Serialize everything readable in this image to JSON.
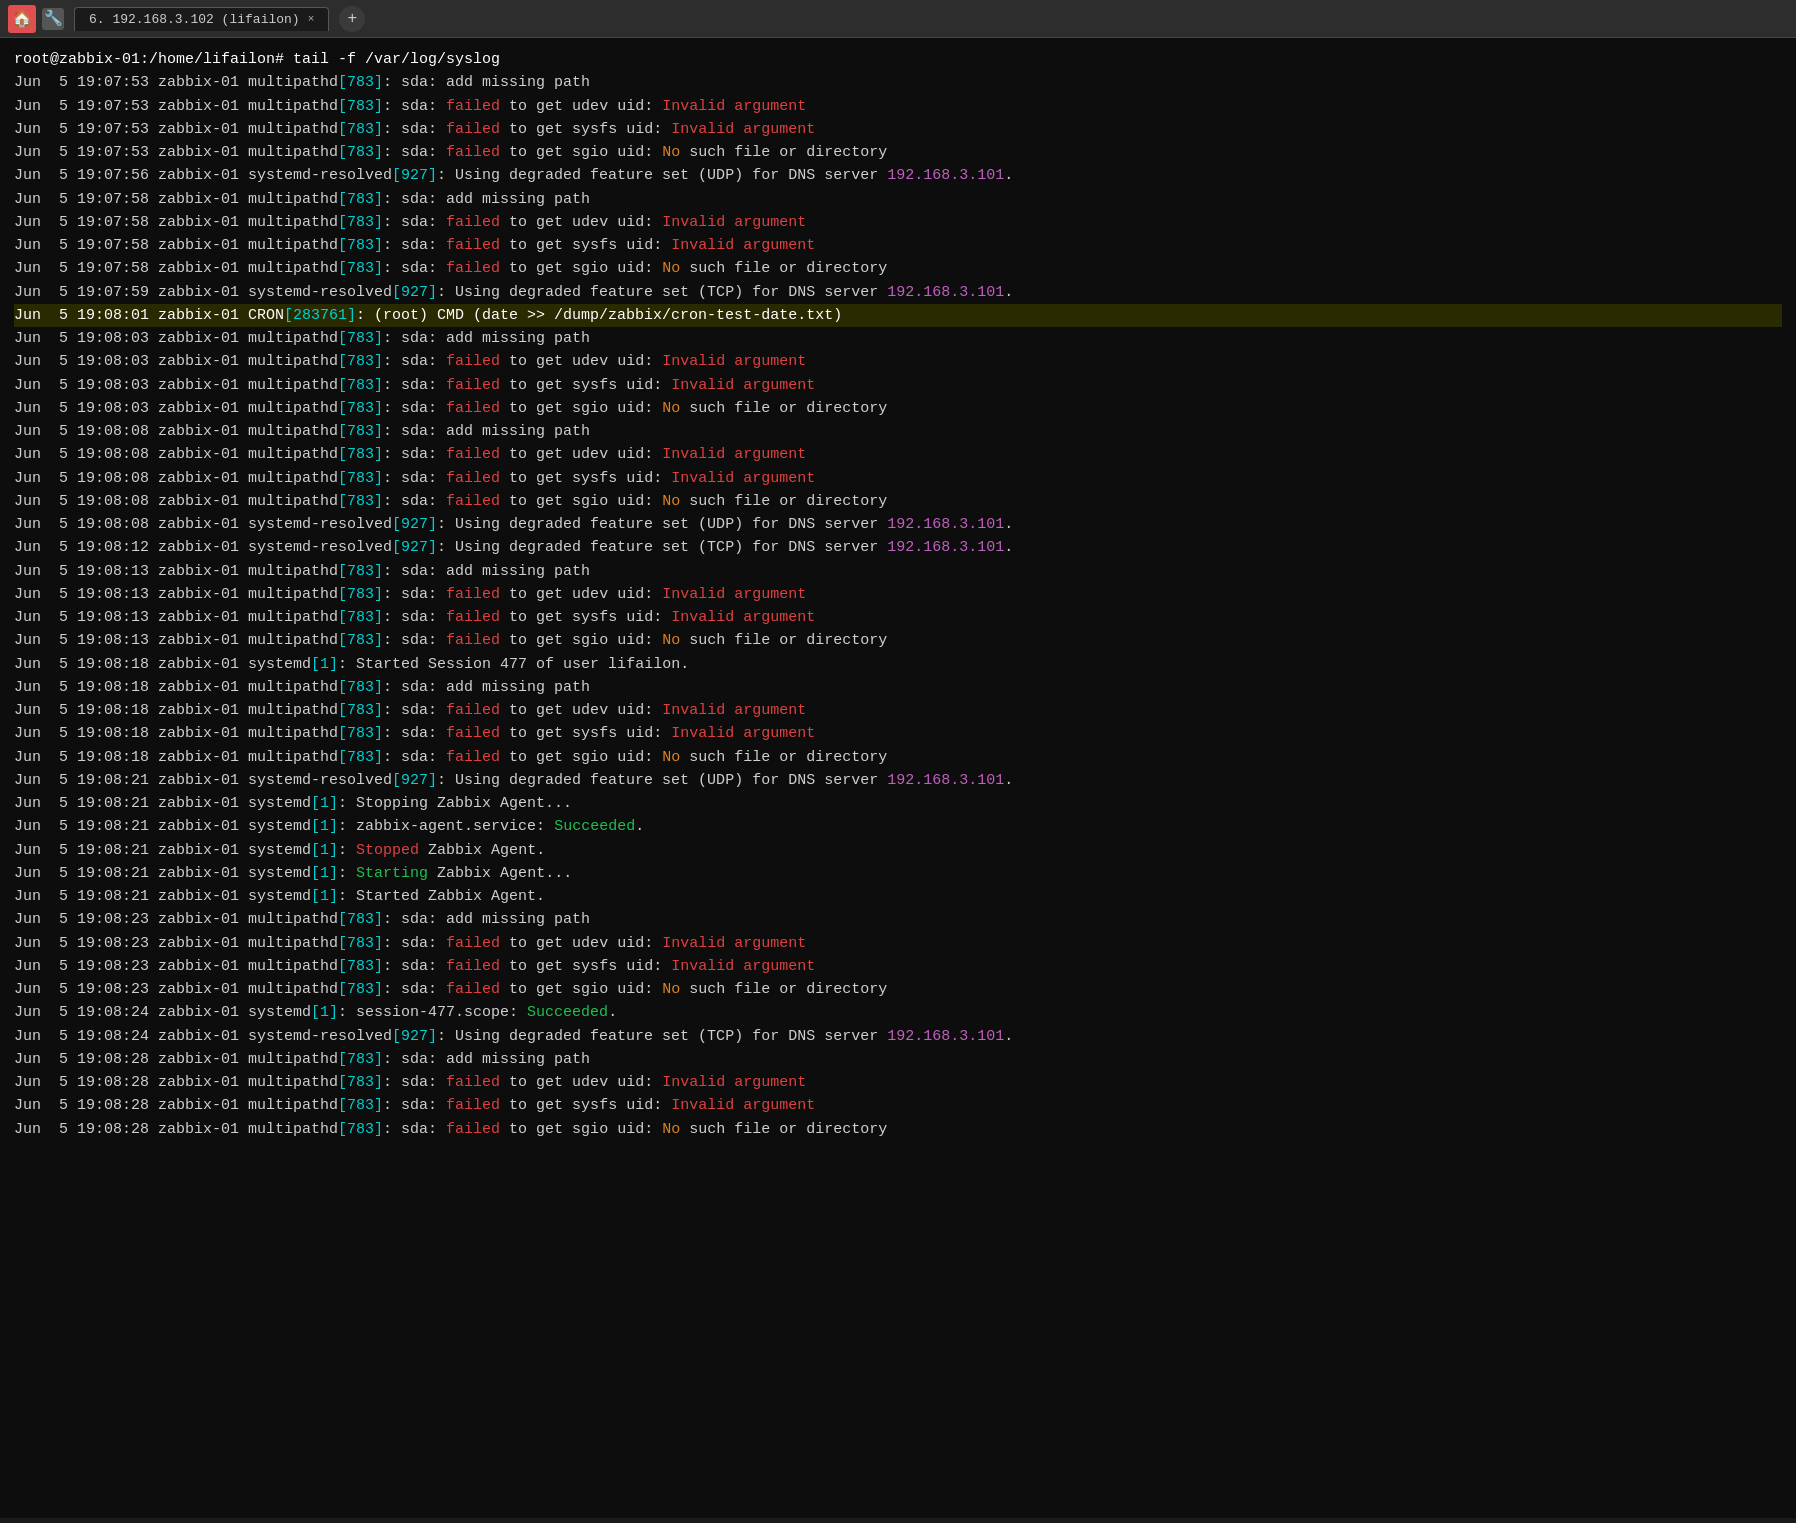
{
  "titlebar": {
    "icon": "🏠",
    "tab_label": "6. 192.168.3.102 (lifailon)",
    "tab_close": "×",
    "add_tab": "+"
  },
  "terminal": {
    "prompt": "root@zabbix-01:/home/lifailon# tail -f /var/log/syslog",
    "lines": [
      {
        "id": 1,
        "prefix": "Jun  5 19:07:53 zabbix-01 multipathd",
        "pid": "[783]",
        "msg": ": sda: add missing path",
        "type": "plain"
      },
      {
        "id": 2,
        "prefix": "Jun  5 19:07:53 zabbix-01 multipathd",
        "pid": "[783]",
        "msg_start": ": sda: ",
        "msg_fail": "failed",
        "msg_end": " to get udev uid: ",
        "msg_err": "Invalid argument",
        "type": "fail"
      },
      {
        "id": 3,
        "prefix": "Jun  5 19:07:53 zabbix-01 multipathd",
        "pid": "[783]",
        "msg_start": ": sda: ",
        "msg_fail": "failed",
        "msg_end": " to get sysfs uid: ",
        "msg_err": "Invalid argument",
        "type": "fail"
      },
      {
        "id": 4,
        "prefix": "Jun  5 19:07:53 zabbix-01 multipathd",
        "pid": "[783]",
        "msg_start": ": sda: ",
        "msg_fail": "failed",
        "msg_end": " to get sgio uid: ",
        "msg_no": "No",
        "msg_no_rest": " such file or directory",
        "type": "fail_no"
      },
      {
        "id": 5,
        "prefix": "Jun  5 19:07:56 zabbix-01 systemd-resolved",
        "pid": "[927]",
        "msg_start": ": Using degraded feature set (UDP) for DNS server ",
        "msg_ip": "192.168.3.101",
        "msg_end": ".",
        "type": "resolved"
      },
      {
        "id": 6,
        "prefix": "Jun  5 19:07:58 zabbix-01 multipathd",
        "pid": "[783]",
        "msg": ": sda: add missing path",
        "type": "plain"
      },
      {
        "id": 7,
        "prefix": "Jun  5 19:07:58 zabbix-01 multipathd",
        "pid": "[783]",
        "msg_start": ": sda: ",
        "msg_fail": "failed",
        "msg_end": " to get udev uid: ",
        "msg_err": "Invalid argument",
        "type": "fail"
      },
      {
        "id": 8,
        "prefix": "Jun  5 19:07:58 zabbix-01 multipathd",
        "pid": "[783]",
        "msg_start": ": sda: ",
        "msg_fail": "failed",
        "msg_end": " to get sysfs uid: ",
        "msg_err": "Invalid argument",
        "type": "fail"
      },
      {
        "id": 9,
        "prefix": "Jun  5 19:07:58 zabbix-01 multipathd",
        "pid": "[783]",
        "msg_start": ": sda: ",
        "msg_fail": "failed",
        "msg_end": " to get sgio uid: ",
        "msg_no": "No",
        "msg_no_rest": " such file or directory",
        "type": "fail_no"
      },
      {
        "id": 10,
        "prefix": "Jun  5 19:07:59 zabbix-01 systemd-resolved",
        "pid": "[927]",
        "msg_start": ": Using degraded feature set (TCP) for DNS server ",
        "msg_ip": "192.168.3.101",
        "msg_end": ".",
        "type": "resolved"
      },
      {
        "id": 11,
        "prefix": "Jun  5 19:08:01 zabbix-01 CRON",
        "pid": "[283761]",
        "msg": ": (root) CMD (date >> /dump/zabbix/cron-test-date.txt)",
        "type": "cron"
      },
      {
        "id": 12,
        "prefix": "Jun  5 19:08:03 zabbix-01 multipathd",
        "pid": "[783]",
        "msg": ": sda: add missing path",
        "type": "plain"
      },
      {
        "id": 13,
        "prefix": "Jun  5 19:08:03 zabbix-01 multipathd",
        "pid": "[783]",
        "msg_start": ": sda: ",
        "msg_fail": "failed",
        "msg_end": " to get udev uid: ",
        "msg_err": "Invalid argument",
        "type": "fail"
      },
      {
        "id": 14,
        "prefix": "Jun  5 19:08:03 zabbix-01 multipathd",
        "pid": "[783]",
        "msg_start": ": sda: ",
        "msg_fail": "failed",
        "msg_end": " to get sysfs uid: ",
        "msg_err": "Invalid argument",
        "type": "fail"
      },
      {
        "id": 15,
        "prefix": "Jun  5 19:08:03 zabbix-01 multipathd",
        "pid": "[783]",
        "msg_start": ": sda: ",
        "msg_fail": "failed",
        "msg_end": " to get sgio uid: ",
        "msg_no": "No",
        "msg_no_rest": " such file or directory",
        "type": "fail_no"
      },
      {
        "id": 16,
        "prefix": "Jun  5 19:08:08 zabbix-01 multipathd",
        "pid": "[783]",
        "msg": ": sda: add missing path",
        "type": "plain"
      },
      {
        "id": 17,
        "prefix": "Jun  5 19:08:08 zabbix-01 multipathd",
        "pid": "[783]",
        "msg_start": ": sda: ",
        "msg_fail": "failed",
        "msg_end": " to get udev uid: ",
        "msg_err": "Invalid argument",
        "type": "fail"
      },
      {
        "id": 18,
        "prefix": "Jun  5 19:08:08 zabbix-01 multipathd",
        "pid": "[783]",
        "msg_start": ": sda: ",
        "msg_fail": "failed",
        "msg_end": " to get sysfs uid: ",
        "msg_err": "Invalid argument",
        "type": "fail"
      },
      {
        "id": 19,
        "prefix": "Jun  5 19:08:08 zabbix-01 multipathd",
        "pid": "[783]",
        "msg_start": ": sda: ",
        "msg_fail": "failed",
        "msg_end": " to get sgio uid: ",
        "msg_no": "No",
        "msg_no_rest": " such file or directory",
        "type": "fail_no"
      },
      {
        "id": 20,
        "prefix": "Jun  5 19:08:08 zabbix-01 systemd-resolved",
        "pid": "[927]",
        "msg_start": ": Using degraded feature set (UDP) for DNS server ",
        "msg_ip": "192.168.3.101",
        "msg_end": ".",
        "type": "resolved"
      },
      {
        "id": 21,
        "prefix": "Jun  5 19:08:12 zabbix-01 systemd-resolved",
        "pid": "[927]",
        "msg_start": ": Using degraded feature set (TCP) for DNS server ",
        "msg_ip": "192.168.3.101",
        "msg_end": ".",
        "type": "resolved"
      },
      {
        "id": 22,
        "prefix": "Jun  5 19:08:13 zabbix-01 multipathd",
        "pid": "[783]",
        "msg": ": sda: add missing path",
        "type": "plain"
      },
      {
        "id": 23,
        "prefix": "Jun  5 19:08:13 zabbix-01 multipathd",
        "pid": "[783]",
        "msg_start": ": sda: ",
        "msg_fail": "failed",
        "msg_end": " to get udev uid: ",
        "msg_err": "Invalid argument",
        "type": "fail"
      },
      {
        "id": 24,
        "prefix": "Jun  5 19:08:13 zabbix-01 multipathd",
        "pid": "[783]",
        "msg_start": ": sda: ",
        "msg_fail": "failed",
        "msg_end": " to get sysfs uid: ",
        "msg_err": "Invalid argument",
        "type": "fail"
      },
      {
        "id": 25,
        "prefix": "Jun  5 19:08:13 zabbix-01 multipathd",
        "pid": "[783]",
        "msg_start": ": sda: ",
        "msg_fail": "failed",
        "msg_end": " to get sgio uid: ",
        "msg_no": "No",
        "msg_no_rest": " such file or directory",
        "type": "fail_no"
      },
      {
        "id": 26,
        "prefix": "Jun  5 19:08:18 zabbix-01 systemd",
        "pid": "[1]",
        "msg": ": Started Session 477 of user lifailon.",
        "type": "plain"
      },
      {
        "id": 27,
        "prefix": "Jun  5 19:08:18 zabbix-01 multipathd",
        "pid": "[783]",
        "msg": ": sda: add missing path",
        "type": "plain"
      },
      {
        "id": 28,
        "prefix": "Jun  5 19:08:18 zabbix-01 multipathd",
        "pid": "[783]",
        "msg_start": ": sda: ",
        "msg_fail": "failed",
        "msg_end": " to get udev uid: ",
        "msg_err": "Invalid argument",
        "type": "fail"
      },
      {
        "id": 29,
        "prefix": "Jun  5 19:08:18 zabbix-01 multipathd",
        "pid": "[783]",
        "msg_start": ": sda: ",
        "msg_fail": "failed",
        "msg_end": " to get sysfs uid: ",
        "msg_err": "Invalid argument",
        "type": "fail"
      },
      {
        "id": 30,
        "prefix": "Jun  5 19:08:18 zabbix-01 multipathd",
        "pid": "[783]",
        "msg_start": ": sda: ",
        "msg_fail": "failed",
        "msg_end": " to get sgio uid: ",
        "msg_no": "No",
        "msg_no_rest": " such file or directory",
        "type": "fail_no"
      },
      {
        "id": 31,
        "prefix": "Jun  5 19:08:21 zabbix-01 systemd-resolved",
        "pid": "[927]",
        "msg_start": ": Using degraded feature set (UDP) for DNS server ",
        "msg_ip": "192.168.3.101",
        "msg_end": ".",
        "type": "resolved"
      },
      {
        "id": 32,
        "prefix": "Jun  5 19:08:21 zabbix-01 systemd",
        "pid": "[1]",
        "msg": ": Stopping Zabbix Agent...",
        "type": "plain"
      },
      {
        "id": 33,
        "prefix": "Jun  5 19:08:21 zabbix-01 systemd",
        "pid": "[1]",
        "msg_start": ": zabbix-agent.service: ",
        "msg_succeeded": "Succeeded",
        "msg_end": ".",
        "type": "succeeded"
      },
      {
        "id": 34,
        "prefix": "Jun  5 19:08:21 zabbix-01 systemd",
        "pid": "[1]",
        "msg_start": ": ",
        "msg_stopped": "Stopped",
        "msg_end": " Zabbix Agent.",
        "type": "stopped"
      },
      {
        "id": 35,
        "prefix": "Jun  5 19:08:21 zabbix-01 systemd",
        "pid": "[1]",
        "msg_start": ": ",
        "msg_starting": "Starting",
        "msg_end": " Zabbix Agent...",
        "type": "starting"
      },
      {
        "id": 36,
        "prefix": "Jun  5 19:08:21 zabbix-01 systemd",
        "pid": "[1]",
        "msg": ": Started Zabbix Agent.",
        "type": "plain"
      },
      {
        "id": 37,
        "prefix": "Jun  5 19:08:23 zabbix-01 multipathd",
        "pid": "[783]",
        "msg": ": sda: add missing path",
        "type": "plain"
      },
      {
        "id": 38,
        "prefix": "Jun  5 19:08:23 zabbix-01 multipathd",
        "pid": "[783]",
        "msg_start": ": sda: ",
        "msg_fail": "failed",
        "msg_end": " to get udev uid: ",
        "msg_err": "Invalid argument",
        "type": "fail"
      },
      {
        "id": 39,
        "prefix": "Jun  5 19:08:23 zabbix-01 multipathd",
        "pid": "[783]",
        "msg_start": ": sda: ",
        "msg_fail": "failed",
        "msg_end": " to get sysfs uid: ",
        "msg_err": "Invalid argument",
        "type": "fail"
      },
      {
        "id": 40,
        "prefix": "Jun  5 19:08:23 zabbix-01 multipathd",
        "pid": "[783]",
        "msg_start": ": sda: ",
        "msg_fail": "failed",
        "msg_end": " to get sgio uid: ",
        "msg_no": "No",
        "msg_no_rest": " such file or directory",
        "type": "fail_no"
      },
      {
        "id": 41,
        "prefix": "Jun  5 19:08:24 zabbix-01 systemd",
        "pid": "[1]",
        "msg_start": ": session-477.scope: ",
        "msg_succeeded": "Succeeded",
        "msg_end": ".",
        "type": "succeeded"
      },
      {
        "id": 42,
        "prefix": "Jun  5 19:08:24 zabbix-01 systemd-resolved",
        "pid": "[927]",
        "msg_start": ": Using degraded feature set (TCP) for DNS server ",
        "msg_ip": "192.168.3.101",
        "msg_end": ".",
        "type": "resolved"
      },
      {
        "id": 43,
        "prefix": "Jun  5 19:08:28 zabbix-01 multipathd",
        "pid": "[783]",
        "msg": ": sda: add missing path",
        "type": "plain"
      },
      {
        "id": 44,
        "prefix": "Jun  5 19:08:28 zabbix-01 multipathd",
        "pid": "[783]",
        "msg_start": ": sda: ",
        "msg_fail": "failed",
        "msg_end": " to get udev uid: ",
        "msg_err": "Invalid argument",
        "type": "fail"
      },
      {
        "id": 45,
        "prefix": "Jun  5 19:08:28 zabbix-01 multipathd",
        "pid": "[783]",
        "msg_start": ": sda: ",
        "msg_fail": "failed",
        "msg_end": " to get sysfs uid: ",
        "msg_err": "Invalid argument",
        "type": "fail"
      },
      {
        "id": 46,
        "prefix": "Jun  5 19:08:28 zabbix-01 multipathd",
        "pid": "[783]",
        "msg_start": ": sda: ",
        "msg_fail": "failed",
        "msg_end": " to get sgio uid: ",
        "msg_no": "No",
        "msg_no_rest": " such file or directory",
        "type": "fail_no"
      }
    ]
  }
}
